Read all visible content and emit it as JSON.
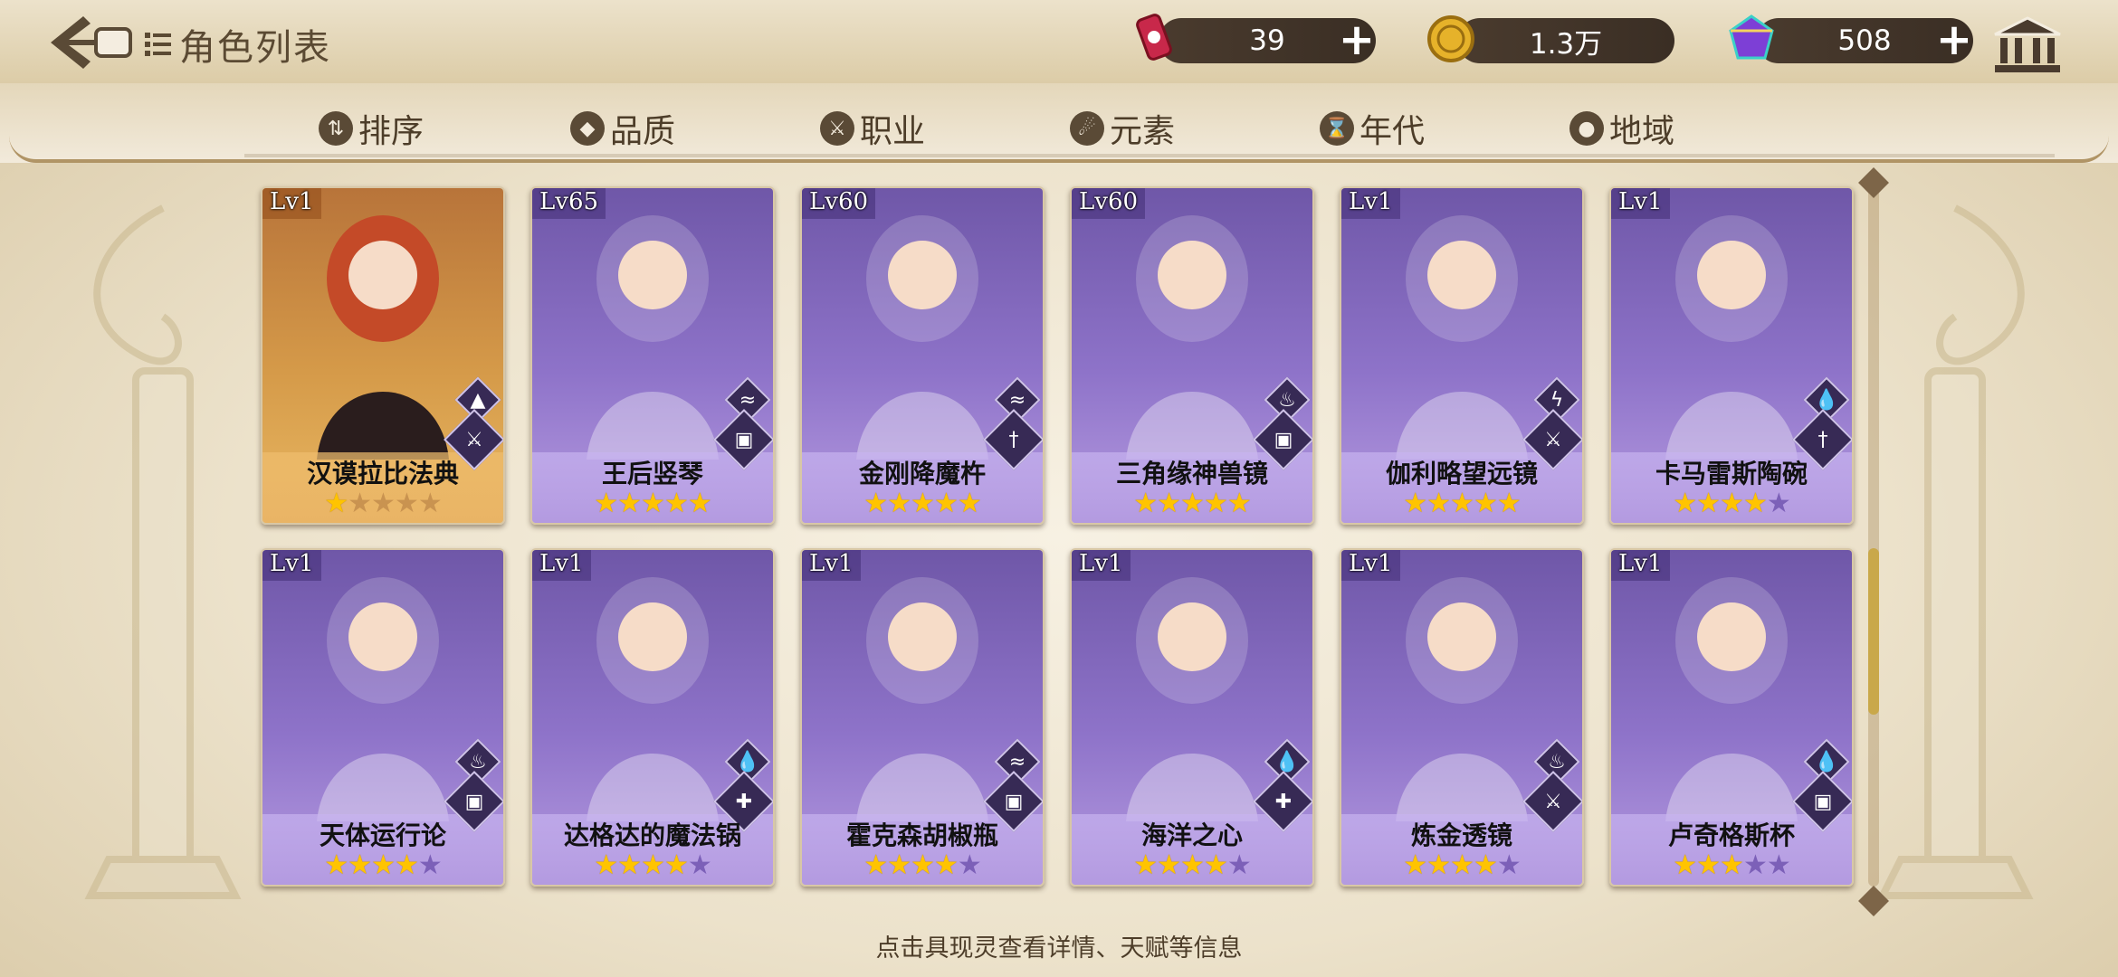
{
  "header": {
    "title": "角色列表",
    "resources": [
      {
        "name": "stamina",
        "value": "39",
        "icon": "can-icon"
      },
      {
        "name": "gold",
        "value": "1.3万",
        "icon": "coin-icon"
      },
      {
        "name": "gems",
        "value": "508",
        "icon": "gem-icon"
      }
    ]
  },
  "tabs": [
    {
      "label": "排序",
      "icon": "sort-icon"
    },
    {
      "label": "品质",
      "icon": "quality-icon"
    },
    {
      "label": "职业",
      "icon": "class-icon"
    },
    {
      "label": "元素",
      "icon": "element-icon"
    },
    {
      "label": "年代",
      "icon": "era-icon"
    },
    {
      "label": "地域",
      "icon": "location-icon"
    }
  ],
  "cards": [
    {
      "level": "Lv1",
      "name": "汉谟拉比法典",
      "stars": 1,
      "max_stars": 5,
      "element": "earth-icon",
      "role": "sword-icon",
      "theme": "gold"
    },
    {
      "level": "Lv65",
      "name": "王后竖琴",
      "stars": 5,
      "max_stars": 5,
      "element": "wind-icon",
      "role": "book-icon",
      "theme": "purple"
    },
    {
      "level": "Lv60",
      "name": "金刚降魔杵",
      "stars": 5,
      "max_stars": 5,
      "element": "wind-icon",
      "role": "dagger-icon",
      "theme": "purple"
    },
    {
      "level": "Lv60",
      "name": "三角缘神兽镜",
      "stars": 5,
      "max_stars": 5,
      "element": "fire-icon",
      "role": "book-icon",
      "theme": "purple"
    },
    {
      "level": "Lv1",
      "name": "伽利略望远镜",
      "stars": 5,
      "max_stars": 5,
      "element": "thunder-icon",
      "role": "sword-icon",
      "theme": "purple"
    },
    {
      "level": "Lv1",
      "name": "卡马雷斯陶碗",
      "stars": 4,
      "max_stars": 5,
      "element": "water-icon",
      "role": "dagger-icon",
      "theme": "purple"
    },
    {
      "level": "Lv1",
      "name": "天体运行论",
      "stars": 4,
      "max_stars": 5,
      "element": "fire-icon",
      "role": "book-icon",
      "theme": "purple"
    },
    {
      "level": "Lv1",
      "name": "达格达的魔法锅",
      "stars": 4,
      "max_stars": 5,
      "element": "water-icon",
      "role": "cross-icon",
      "theme": "purple"
    },
    {
      "level": "Lv1",
      "name": "霍克森胡椒瓶",
      "stars": 4,
      "max_stars": 5,
      "element": "wind-icon",
      "role": "book-icon",
      "theme": "purple"
    },
    {
      "level": "Lv1",
      "name": "海洋之心",
      "stars": 4,
      "max_stars": 5,
      "element": "water-icon",
      "role": "cross-icon",
      "theme": "purple"
    },
    {
      "level": "Lv1",
      "name": "炼金透镜",
      "stars": 4,
      "max_stars": 5,
      "element": "fire-icon",
      "role": "sword-icon",
      "theme": "purple"
    },
    {
      "level": "Lv1",
      "name": "卢奇格斯杯",
      "stars": 3,
      "max_stars": 5,
      "element": "water-icon",
      "role": "book-icon",
      "theme": "purple"
    }
  ],
  "hint": "点击具现灵查看详情、天赋等信息",
  "colors": {
    "gold_card": "#d79a3c",
    "purple_card": "#8e73c9",
    "star": "#ffc400",
    "header_text": "#5b4a33"
  }
}
